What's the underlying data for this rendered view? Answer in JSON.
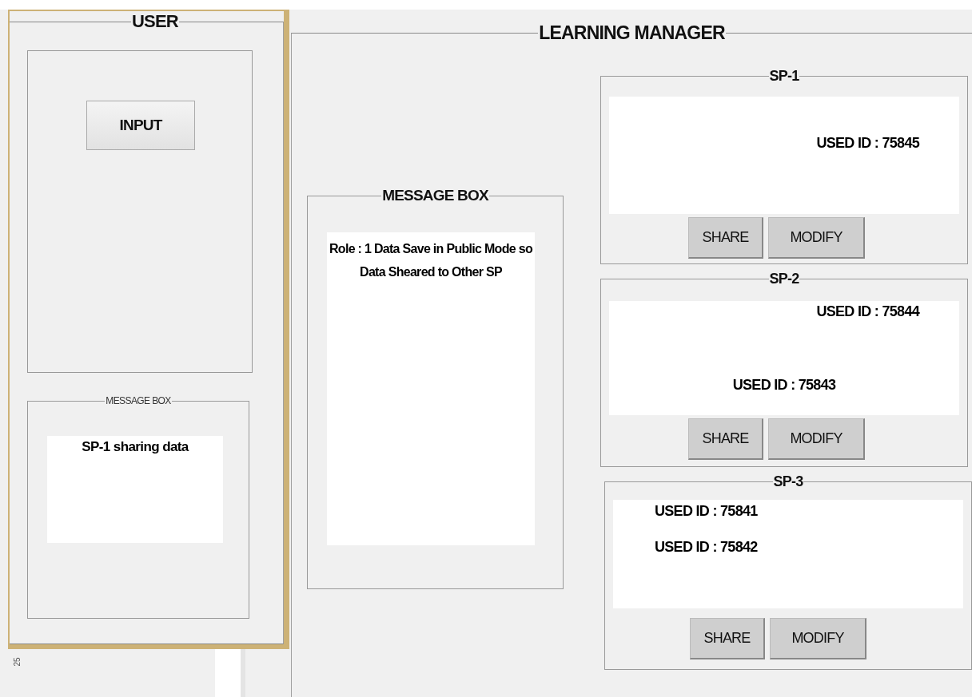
{
  "user_panel": {
    "title": "USER",
    "input_button": "INPUT",
    "message_box": {
      "title": "MESSAGE BOX",
      "text": "SP-1 sharing data"
    }
  },
  "ruler_label": "25",
  "learning_manager": {
    "title": "LEARNING MANAGER",
    "message_box": {
      "title": "MESSAGE BOX",
      "text": "Role : 1 Data Save in Public Mode so Data Sheared to Other SP"
    },
    "service_providers": [
      {
        "title": "SP-1",
        "lines": [
          "USED ID : 75845"
        ],
        "buttons": [
          "SHARE",
          "MODIFY"
        ]
      },
      {
        "title": "SP-2",
        "lines": [
          "USED ID : 75844",
          "USED ID : 75843"
        ],
        "buttons": [
          "SHARE",
          "MODIFY"
        ]
      },
      {
        "title": "SP-3",
        "lines": [
          "USED ID : 75841",
          "USED ID : 75842"
        ],
        "buttons": [
          "SHARE",
          "MODIFY"
        ]
      }
    ]
  }
}
